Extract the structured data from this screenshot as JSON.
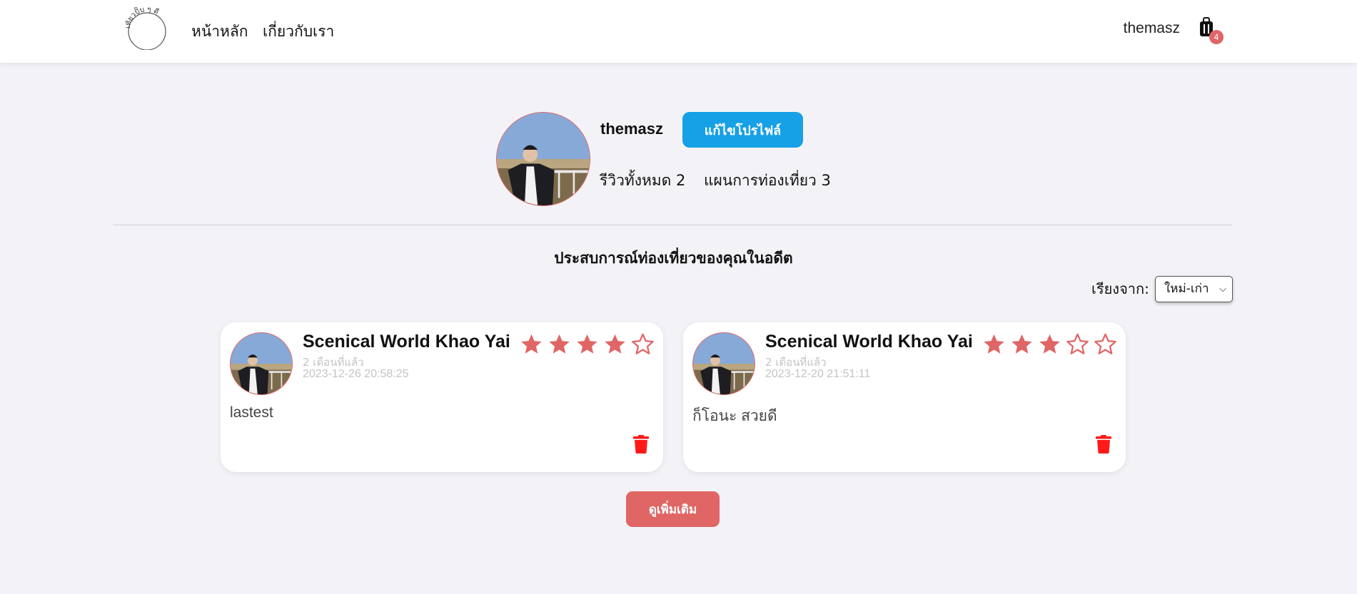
{
  "navbar": {
    "logo_text": "เที่ยวปั๊บ ๆ ดี",
    "links": [
      {
        "label": "หน้าหลัก"
      },
      {
        "label": "เกี่ยวกับเรา"
      }
    ],
    "username": "themasz",
    "cart_icon": "luggage-icon",
    "cart_count": "4"
  },
  "profile": {
    "name": "themasz",
    "edit_label": "แก้ไขโปรไฟล์",
    "reviews_stat": "รีวิวทั้งหมด 2",
    "plans_stat": "แผนการท่องเที่ยว 3"
  },
  "section": {
    "title": "ประสบการณ์ท่องเที่ยวของคุณในอดีต",
    "sort_label": "เรียงจาก:",
    "sort_value": "ใหม่-เก่า"
  },
  "reviews": [
    {
      "place": "Scenical World Khao Yai",
      "ago": "2 เดือนที่แล้ว",
      "date": "2023-12-26 20:58:25",
      "rating": 4,
      "text": "lastest"
    },
    {
      "place": "Scenical World Khao Yai",
      "ago": "2 เดือนที่แล้ว",
      "date": "2023-12-20 21:51:11",
      "rating": 3,
      "text": "ก็โอนะ สวยดี"
    }
  ],
  "more_label": "ดูเพิ่มเติม",
  "colors": {
    "accent_red": "#e06666",
    "primary_blue": "#16a0e6",
    "trash_red": "#ff1a1a",
    "background": "#f3f3f7"
  }
}
